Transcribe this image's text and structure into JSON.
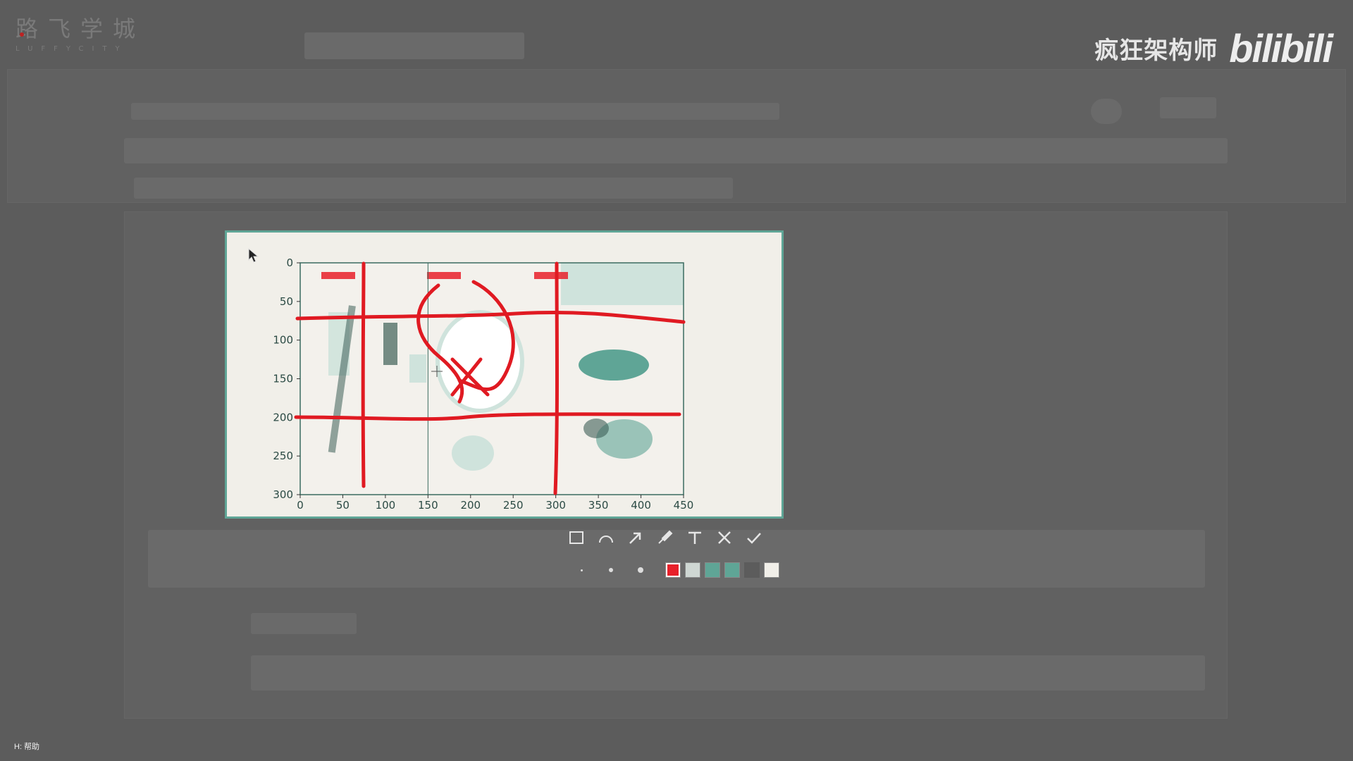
{
  "brand": {
    "name_cn": "路飞学城",
    "name_en": "LUFFYCITY"
  },
  "watermark": {
    "text": "疯狂架构师",
    "logo": "bilibili"
  },
  "help_hint": "H: 帮助",
  "chart_data": {
    "type": "image",
    "x_ticks": [
      "0",
      "50",
      "100",
      "150",
      "200",
      "250",
      "300",
      "350",
      "400",
      "450"
    ],
    "y_ticks": [
      "0",
      "50",
      "100",
      "150",
      "200",
      "250",
      "300"
    ],
    "xlim": [
      0,
      450
    ],
    "ylim": [
      300,
      0
    ],
    "panel_boundaries_x": [
      150,
      300
    ]
  },
  "annotation_toolbar": {
    "tools": [
      {
        "name": "rectangle-tool",
        "icon": "rectangle-icon"
      },
      {
        "name": "ellipse-tool",
        "icon": "ellipse-icon"
      },
      {
        "name": "arrow-tool",
        "icon": "arrow-icon"
      },
      {
        "name": "brush-tool",
        "icon": "brush-icon"
      },
      {
        "name": "text-tool",
        "icon": "text-icon"
      },
      {
        "name": "cancel-tool",
        "icon": "close-icon"
      },
      {
        "name": "confirm-tool",
        "icon": "check-icon"
      }
    ],
    "sizes": [
      "small",
      "medium",
      "large"
    ],
    "colors": [
      "#e8202a",
      "#cfd7d3",
      "#5fa596",
      "#5fa596",
      "#5c5c5c",
      "#f1efe9"
    ],
    "selected_color": "#e8202a"
  }
}
